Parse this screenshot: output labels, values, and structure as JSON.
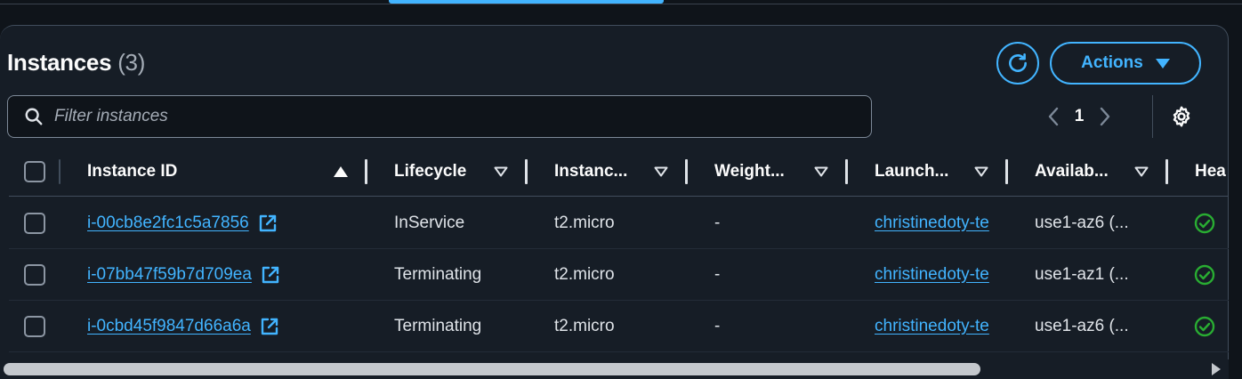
{
  "header": {
    "title": "Instances",
    "count": "(3)",
    "actions_label": "Actions",
    "refresh_icon": "refresh-icon"
  },
  "search": {
    "placeholder": "Filter instances",
    "icon": "search-icon"
  },
  "pagination": {
    "current_page": "1"
  },
  "colors": {
    "accent": "#42b4ff",
    "background": "#161d26",
    "success": "#29ad32"
  },
  "table": {
    "columns": [
      {
        "label": "Instance ID",
        "sort": "ascending"
      },
      {
        "label": "Lifecycle"
      },
      {
        "label": "Instanc..."
      },
      {
        "label": "Weight..."
      },
      {
        "label": "Launch..."
      },
      {
        "label": "Availab..."
      },
      {
        "label": "Hea"
      }
    ],
    "rows": [
      {
        "instance_id": "i-00cb8e2fc1c5a7856",
        "lifecycle": "InService",
        "instance_type": "t2.micro",
        "weight": "-",
        "launch": "christinedoty-te",
        "az": "use1-az6 (...",
        "health": "check-circle-icon"
      },
      {
        "instance_id": "i-07bb47f59b7d709ea",
        "lifecycle": "Terminating",
        "instance_type": "t2.micro",
        "weight": "-",
        "launch": "christinedoty-te",
        "az": "use1-az1 (...",
        "health": "check-circle-icon"
      },
      {
        "instance_id": "i-0cbd45f9847d66a6a",
        "lifecycle": "Terminating",
        "instance_type": "t2.micro",
        "weight": "-",
        "launch": "christinedoty-te",
        "az": "use1-az6 (...",
        "health": "check-circle-icon"
      }
    ]
  }
}
